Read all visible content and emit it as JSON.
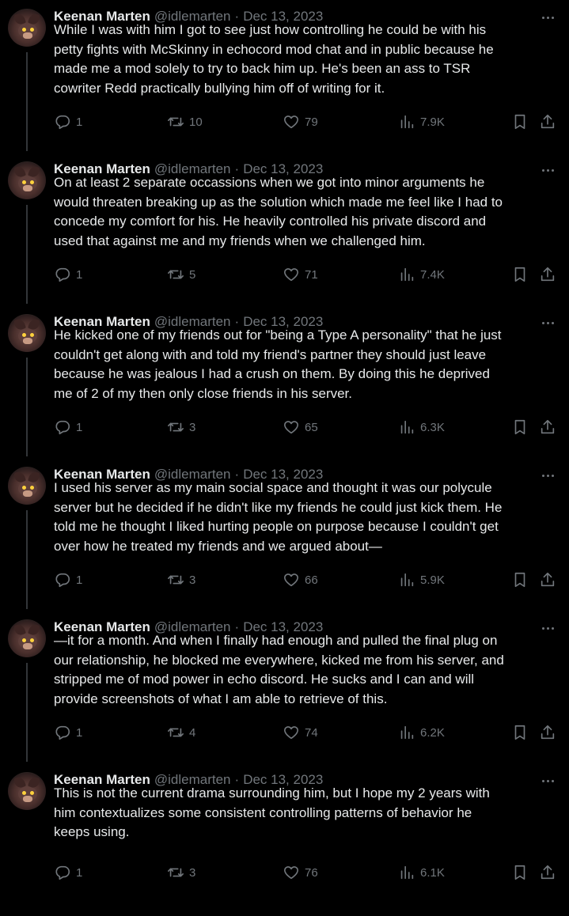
{
  "author": {
    "name": "Keenan Marten",
    "handle": "@idlemarten",
    "separator": "·",
    "date": "Dec 13, 2023"
  },
  "tweets": [
    {
      "text": "While I was with him I got to see just how controlling he could be with his\npetty fights with McSkinny in echocord mod chat and in public because he\nmade me a mod solely to try to back him up. He's been an ass to  TSR\ncowriter Redd practically bullying him off of writing for it.",
      "replies": "1",
      "retweets": "10",
      "likes": "79",
      "views": "7.9K"
    },
    {
      "text": "On at least 2 separate occassions when we got into minor arguments he\nwould threaten breaking up as the solution which made me feel like I had to\nconcede my comfort for his. He heavily controlled his private discord and\nused that against me and my friends when we challenged him.",
      "replies": "1",
      "retweets": "5",
      "likes": "71",
      "views": "7.4K"
    },
    {
      "text": "He kicked one of my friends out for \"being a Type A personality\" that he just\ncouldn't get along with and told my friend's partner they should just leave\nbecause he was jealous I had a crush on them. By doing this he deprived\nme of 2 of my then only close friends in his server.",
      "replies": "1",
      "retweets": "3",
      "likes": "65",
      "views": "6.3K"
    },
    {
      "text": "I used his server as my main social space and thought it was our polycule\nserver but he decided if he didn't like my friends he could just kick them. He\ntold me he thought I liked hurting people on purpose because I couldn't get\nover how he treated my friends and we argued about—",
      "replies": "1",
      "retweets": "3",
      "likes": "66",
      "views": "5.9K"
    },
    {
      "text": "—it for a month. And when I finally had enough and pulled the final plug on\nour relationship, he blocked me everywhere, kicked me from his server, and\nstripped me of mod power in echo discord. He sucks and I can and will\nprovide screenshots of what I am able to retrieve of this.",
      "replies": "1",
      "retweets": "4",
      "likes": "74",
      "views": "6.2K"
    },
    {
      "text": "This is not the current drama surrounding him, but I hope my 2 years with\nhim contextualizes some consistent controlling patterns of behavior he\nkeeps using.",
      "replies": "1",
      "retweets": "3",
      "likes": "76",
      "views": "6.1K"
    }
  ],
  "icons": {
    "reply": "reply-icon",
    "retweet": "retweet-icon",
    "like": "heart-icon",
    "views": "views-icon",
    "bookmark": "bookmark-icon",
    "share": "share-icon",
    "more": "more-icon"
  },
  "colors": {
    "background": "#000000",
    "text": "#e7e9ea",
    "muted": "#71767b",
    "thread_line": "#333639"
  }
}
